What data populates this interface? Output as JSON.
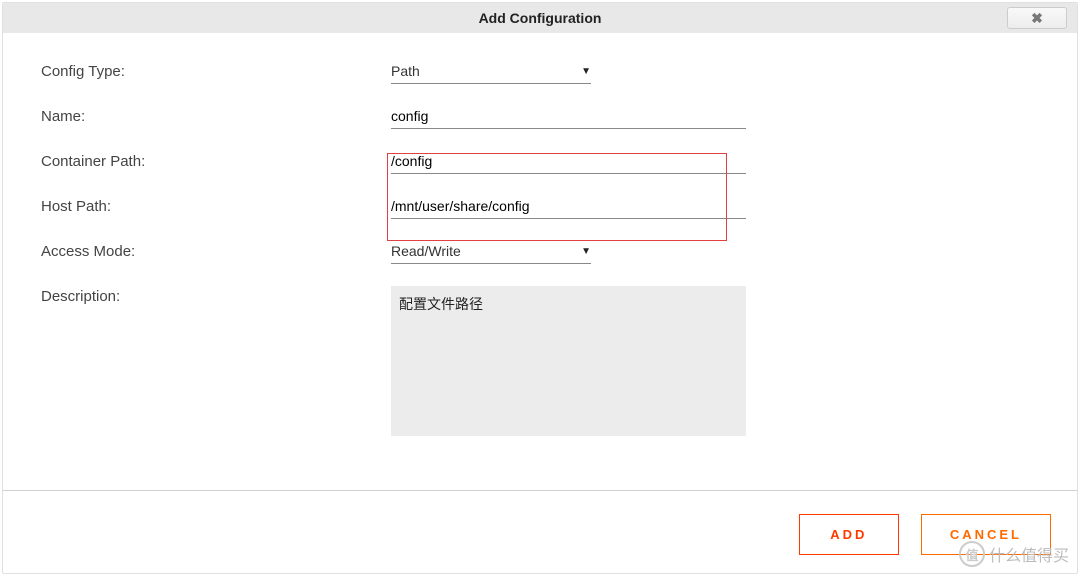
{
  "dialog": {
    "title": "Add Configuration",
    "close_symbol": "✖"
  },
  "labels": {
    "config_type": "Config Type:",
    "name": "Name:",
    "container_path": "Container Path:",
    "host_path": "Host Path:",
    "access_mode": "Access Mode:",
    "description": "Description:"
  },
  "fields": {
    "config_type": {
      "value": "Path"
    },
    "name": {
      "value": "config"
    },
    "container_path": {
      "value": "/config"
    },
    "host_path": {
      "value": "/mnt/user/share/config"
    },
    "access_mode": {
      "value": "Read/Write"
    },
    "description": {
      "value": "配置文件路径"
    }
  },
  "buttons": {
    "add": "ADD",
    "cancel": "CANCEL"
  },
  "watermark": {
    "badge": "值",
    "text": "什么值得买"
  }
}
